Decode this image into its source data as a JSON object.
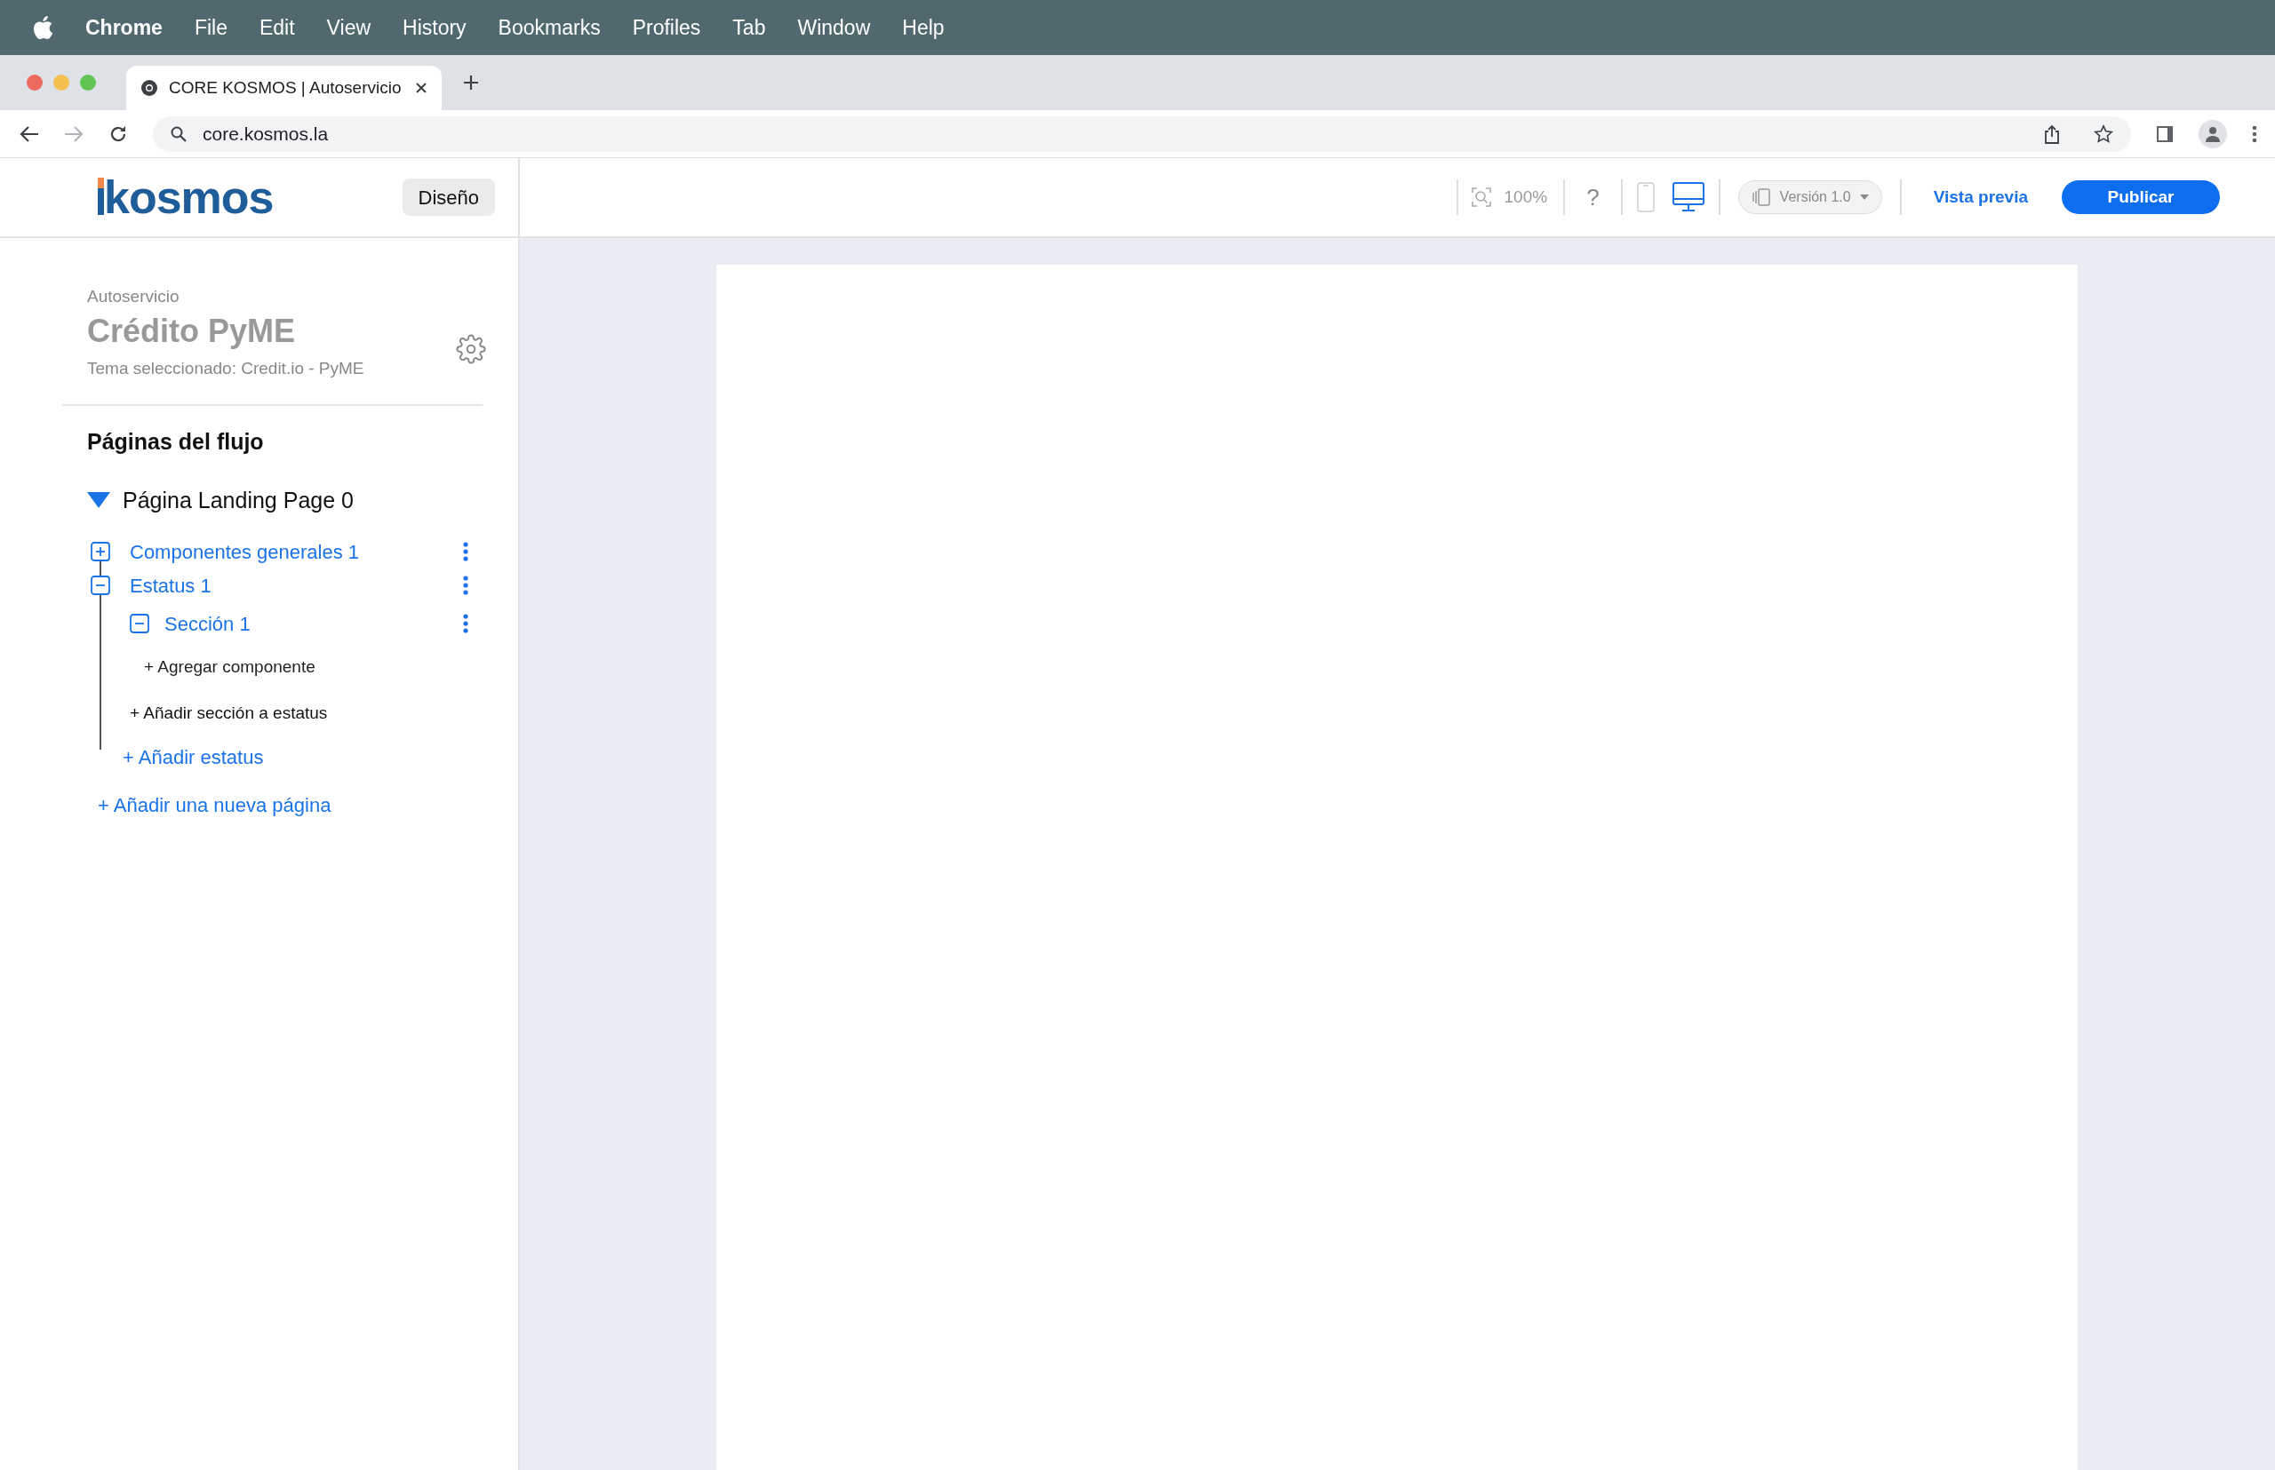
{
  "menubar": {
    "app": "Chrome",
    "items": [
      "File",
      "Edit",
      "View",
      "History",
      "Bookmarks",
      "Profiles",
      "Tab",
      "Window",
      "Help"
    ]
  },
  "browser": {
    "tab_title": "CORE KOSMOS | Autoservicio",
    "address": "core.kosmos.la"
  },
  "header": {
    "logo": "kosmos",
    "mode_button": "Diseño",
    "zoom": "100%",
    "help": "?",
    "devices": [
      {
        "kind": "mobile",
        "selected": false
      },
      {
        "kind": "desktop",
        "selected": true
      }
    ],
    "version": "Versión 1.0",
    "preview": "Vista previa",
    "publish": "Publicar"
  },
  "sidebar": {
    "category": "Autoservicio",
    "title": "Crédito PyME",
    "theme": "Tema seleccionado: Credit.io - PyME",
    "section_title": "Páginas del flujo",
    "page": {
      "title": "Página Landing Page 0",
      "expanded": true,
      "items": [
        {
          "label": "Componentes generales 1",
          "expanded": false
        },
        {
          "label": "Estatus 1",
          "expanded": true,
          "sections": [
            {
              "label": "Sección 1",
              "expanded": true,
              "add_component": "+ Agregar componente"
            }
          ],
          "add_section": "+ Añadir sección a estatus"
        }
      ],
      "add_status": "+ Añadir estatus"
    },
    "add_page": "+ Añadir una nueva página"
  }
}
